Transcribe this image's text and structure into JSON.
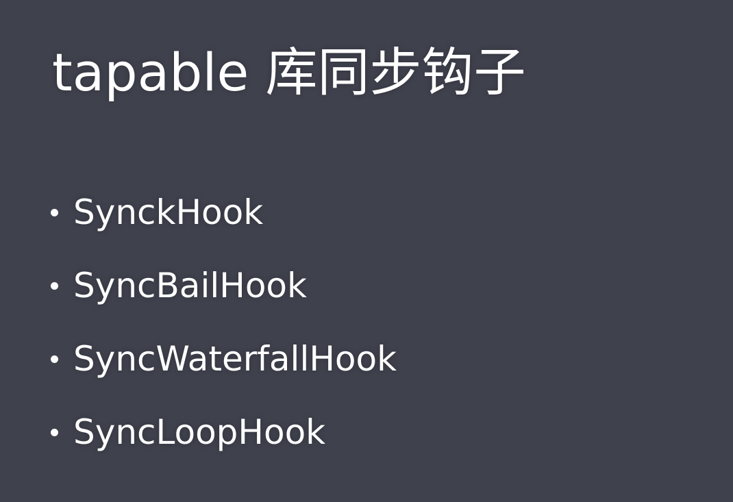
{
  "slide": {
    "title": "tapable 库同步钩子",
    "items": [
      {
        "label": "SynckHook"
      },
      {
        "label": "SyncBailHook"
      },
      {
        "label": "SyncWaterfallHook"
      },
      {
        "label": "SyncLoopHook"
      }
    ]
  },
  "colors": {
    "background": "#3f414d",
    "text": "#ffffff"
  }
}
